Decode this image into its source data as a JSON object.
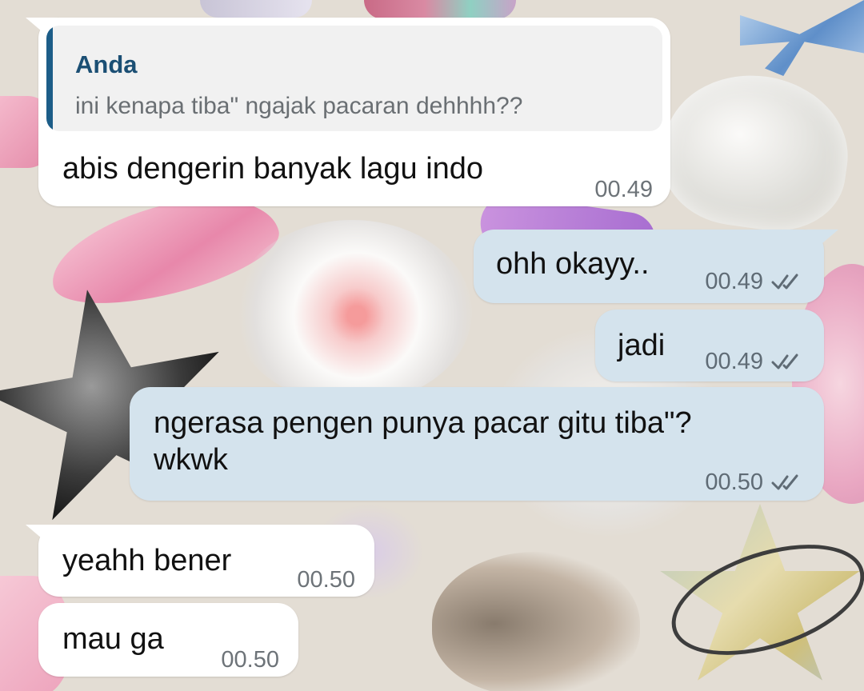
{
  "chat": {
    "messages": [
      {
        "direction": "incoming",
        "reply_to": {
          "author": "Anda",
          "text": "ini kenapa tiba\" ngajak pacaran dehhhh??"
        },
        "text": "abis dengerin banyak lagu indo",
        "time": "00.49"
      },
      {
        "direction": "outgoing",
        "text": "ohh okayy..",
        "time": "00.49",
        "status": "read"
      },
      {
        "direction": "outgoing",
        "text": "jadi",
        "time": "00.49",
        "status": "read"
      },
      {
        "direction": "outgoing",
        "text": "ngerasa pengen punya pacar gitu tiba\"?\nwkwk",
        "time": "00.50",
        "status": "read"
      },
      {
        "direction": "incoming",
        "text": "yeahh bener",
        "time": "00.50"
      },
      {
        "direction": "incoming",
        "text": "mau ga",
        "time": "00.50"
      }
    ]
  },
  "colors": {
    "incoming_bubble": "#ffffff",
    "outgoing_bubble": "#d4e3ed",
    "quote_accent": "#1c5d88",
    "wallpaper": "#e3ddd4"
  },
  "icons": {
    "read_receipt": "double-check-icon"
  }
}
